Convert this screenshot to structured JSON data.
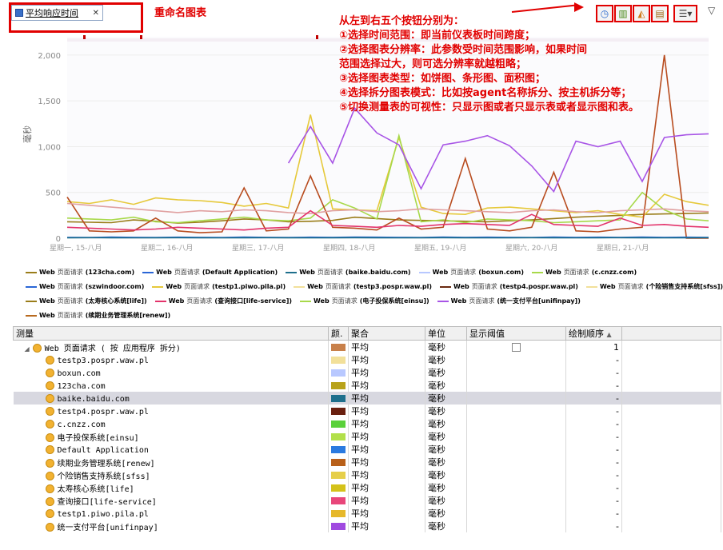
{
  "tab": {
    "title": "平均响应时间"
  },
  "annotations": {
    "rename": "重命名图表",
    "lines": [
      "从左到右五个按钮分别为：",
      "①选择时间范围：即当前仪表板时间跨度；",
      "②选择图表分辨率：此参数受时间范围影响，如果时间",
      "范围选择过大，则可选分辨率就越粗略；",
      "③选择图表类型：如饼图、条形图、面积图；",
      "④选择拆分图表模式：比如按agent名称拆分、按主机拆分等；",
      "⑤切换测量表的可视性：只显示图或者只显示表或者显示图和表。"
    ]
  },
  "toolbar": {
    "menu_glyph": "▽"
  },
  "chart_data": {
    "type": "line",
    "ylabel": "毫秒",
    "xlabel": "",
    "ylim": [
      0,
      2200
    ],
    "yticks": [
      "0",
      "500",
      "1,000",
      "1,500",
      "2,000"
    ],
    "x_ticks": [
      "星期一, 15-八月",
      "星期二, 16-八月",
      "星期三, 17-八月",
      "星期四, 18-八月",
      "星期五, 19-八月",
      "星期六, 20-八月",
      "星期日, 21-八月"
    ],
    "x_count": 30,
    "series": [
      {
        "color": "#9a7d1a",
        "values": [
          180,
          175,
          170,
          200,
          185,
          165,
          175,
          190,
          210,
          200,
          180,
          185,
          195,
          230,
          215,
          200,
          195,
          190,
          185,
          180,
          190,
          200,
          215,
          230,
          240,
          250,
          260,
          265,
          270,
          275
        ]
      },
      {
        "color": "#e6c93b",
        "values": [
          400,
          380,
          420,
          370,
          440,
          420,
          410,
          390,
          350,
          380,
          330,
          1350,
          320,
          310,
          300,
          1100,
          340,
          270,
          260,
          330,
          340,
          320,
          300,
          280,
          300,
          260,
          230,
          480,
          400,
          360
        ]
      },
      {
        "color": "#a8d94a",
        "values": [
          220,
          210,
          200,
          230,
          180,
          170,
          190,
          210,
          230,
          200,
          190,
          220,
          420,
          330,
          210,
          1120,
          180,
          200,
          170,
          210,
          200,
          190,
          170,
          180,
          190,
          200,
          500,
          310,
          210,
          190
        ]
      },
      {
        "color": "#b84c1f",
        "values": [
          450,
          80,
          70,
          80,
          220,
          80,
          60,
          70,
          550,
          80,
          100,
          680,
          120,
          110,
          90,
          220,
          100,
          120,
          870,
          100,
          80,
          120,
          720,
          80,
          70,
          100,
          120,
          2000,
          0,
          0
        ]
      },
      {
        "color": "#e0a0a0",
        "values": [
          380,
          360,
          340,
          320,
          300,
          280,
          300,
          290,
          310,
          300,
          280,
          270,
          300,
          310,
          290,
          300,
          320,
          310,
          300,
          290,
          280,
          300,
          310,
          290,
          280,
          300,
          310,
          320,
          300,
          290
        ]
      },
      {
        "color": "#e3336b",
        "values": [
          120,
          110,
          100,
          90,
          100,
          120,
          110,
          100,
          90,
          110,
          120,
          300,
          140,
          130,
          120,
          140,
          130,
          150,
          160,
          150,
          140,
          260,
          150,
          140,
          130,
          220,
          140,
          150,
          130,
          120
        ]
      },
      {
        "color": "#a855e6",
        "values": [
          null,
          null,
          null,
          null,
          null,
          null,
          null,
          null,
          null,
          null,
          820,
          1220,
          820,
          1420,
          1150,
          1020,
          540,
          1020,
          1060,
          1120,
          1010,
          790,
          510,
          1060,
          1000,
          1060,
          620,
          1100,
          1130,
          1140
        ]
      },
      {
        "color": "#2a66d6",
        "values": [
          10,
          8,
          12,
          10,
          9,
          11,
          10,
          8,
          12,
          10,
          9,
          11,
          10,
          12,
          11,
          10,
          9,
          12,
          10,
          11,
          10,
          9,
          12,
          10,
          11,
          10,
          12,
          10,
          11,
          10
        ]
      },
      {
        "color": "#1e6f8c",
        "values": [
          5,
          6,
          5,
          4,
          5,
          6,
          5,
          4,
          5,
          6,
          5,
          4,
          5,
          6,
          5,
          4,
          5,
          6,
          5,
          4,
          5,
          6,
          5,
          4,
          5,
          6,
          5,
          4,
          5,
          6
        ]
      }
    ]
  },
  "legend": {
    "rows": [
      [
        {
          "color": "#9a7d1a",
          "prefix": "Web",
          "mid": "页面请求",
          "tail": "(123cha.com)"
        },
        {
          "color": "#2a66d6",
          "prefix": "Web",
          "mid": "页面请求",
          "tail": "(Default Application)"
        },
        {
          "color": "#1e6f8c",
          "prefix": "Web",
          "mid": "页面请求",
          "tail": "(baike.baidu.com)"
        },
        {
          "color": "#b8c8ff",
          "prefix": "Web",
          "mid": "页面请求",
          "tail": "(boxun.com)"
        },
        {
          "color": "#a8d94a",
          "prefix": "Web",
          "mid": "页面请求",
          "tail": "(c.cnzz.com)"
        }
      ],
      [
        {
          "color": "#2a66d6",
          "prefix": "Web",
          "mid": "页面请求",
          "tail": "(szwindoor.com)"
        },
        {
          "color": "#e6c93b",
          "prefix": "Web",
          "mid": "页面请求",
          "tail": "(testp1.piwo.pila.pl)"
        },
        {
          "color": "#f2e09a",
          "prefix": "Web",
          "mid": "页面请求",
          "tail": "(testp3.pospr.waw.pl)"
        },
        {
          "color": "#6a2a10",
          "prefix": "Web",
          "mid": "页面请求",
          "tail": "(testp4.pospr.waw.pl)"
        },
        {
          "color": "#f2e09a",
          "prefix": "Web",
          "mid": "页面请求",
          "tail": "(个险销售支持系统[sfss])"
        }
      ],
      [
        {
          "color": "#9a7d1a",
          "prefix": "Web",
          "mid": "页面请求",
          "tail": "(太寿核心系统[life])"
        },
        {
          "color": "#e3336b",
          "prefix": "Web",
          "mid": "页面请求",
          "tail": "(查询接口[life-service])"
        },
        {
          "color": "#a8d94a",
          "prefix": "Web",
          "mid": "页面请求",
          "tail": "(电子投保系统[einsu])"
        },
        {
          "color": "#a855e6",
          "prefix": "Web",
          "mid": "页面请求",
          "tail": "(统一支付平台[unifinpay])"
        }
      ],
      [
        {
          "color": "#b86a1f",
          "prefix": "Web",
          "mid": "页面请求",
          "tail": "(续期业务管理系统[renew])"
        }
      ]
    ]
  },
  "table": {
    "headers": [
      "测量",
      "颜.",
      "聚合",
      "单位",
      "显示阈值",
      "绘制顺序"
    ],
    "sort_glyph": "▲",
    "group": {
      "label": "Web 页面请求 ( 按 应用程序 拆分)",
      "color": "#c8804a",
      "agg": "平均",
      "unit": "毫秒",
      "order": "1"
    },
    "rows": [
      {
        "label": "testp3.pospr.waw.pl",
        "color": "#f2e09a",
        "agg": "平均",
        "unit": "毫秒",
        "order": "-"
      },
      {
        "label": "boxun.com",
        "color": "#b8c8ff",
        "agg": "平均",
        "unit": "毫秒",
        "order": "-"
      },
      {
        "label": "123cha.com",
        "color": "#b8a21a",
        "agg": "平均",
        "unit": "毫秒",
        "order": "-"
      },
      {
        "label": "baike.baidu.com",
        "color": "#1e6f8c",
        "agg": "平均",
        "unit": "毫秒",
        "order": "-",
        "selected": true
      },
      {
        "label": "testp4.pospr.waw.pl",
        "color": "#6a2010",
        "agg": "平均",
        "unit": "毫秒",
        "order": "-"
      },
      {
        "label": "c.cnzz.com",
        "color": "#5ad13a",
        "agg": "平均",
        "unit": "毫秒",
        "order": "-"
      },
      {
        "label": "电子投保系统[einsu]",
        "color": "#b2e04a",
        "agg": "平均",
        "unit": "毫秒",
        "order": "-"
      },
      {
        "label": "Default Application",
        "color": "#2a7ae0",
        "agg": "平均",
        "unit": "毫秒",
        "order": "-"
      },
      {
        "label": "续期业务管理系统[renew]",
        "color": "#b8601a",
        "agg": "平均",
        "unit": "毫秒",
        "order": "-"
      },
      {
        "label": "个险销售支持系统[sfss]",
        "color": "#e6cf4a",
        "agg": "平均",
        "unit": "毫秒",
        "order": "-"
      },
      {
        "label": "太寿核心系统[life]",
        "color": "#d4c21a",
        "agg": "平均",
        "unit": "毫秒",
        "order": "-"
      },
      {
        "label": "查询接口[life-service]",
        "color": "#e8467a",
        "agg": "平均",
        "unit": "毫秒",
        "order": "-"
      },
      {
        "label": "testp1.piwo.pila.pl",
        "color": "#e6b82a",
        "agg": "平均",
        "unit": "毫秒",
        "order": "-"
      },
      {
        "label": "统一支付平台[unifinpay]",
        "color": "#a04ae0",
        "agg": "平均",
        "unit": "毫秒",
        "order": "-"
      }
    ]
  }
}
